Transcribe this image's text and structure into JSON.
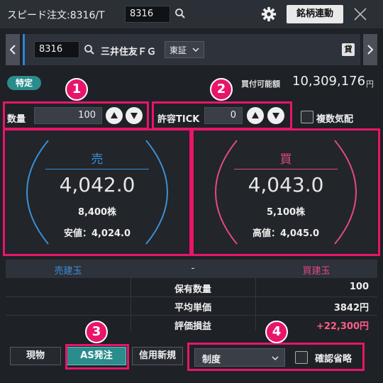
{
  "titlebar": {
    "title": "スピード注文:8316/T",
    "code_value": "8316",
    "link_button_label": "銘柄連動"
  },
  "stock": {
    "code_value": "8316",
    "name": "三井住友ＦＧ",
    "market": "東証",
    "loan_badge": "貸"
  },
  "account": {
    "tag": "特定",
    "buying_power_label": "買付可能額",
    "buying_power_value": "10,309,176",
    "buying_power_unit": "円"
  },
  "quantity": {
    "label": "数量",
    "value": "100"
  },
  "tick": {
    "label": "許容TICK",
    "value": "0"
  },
  "multi_display": {
    "label": "複数気配",
    "checked": false
  },
  "sell_panel": {
    "side": "売",
    "price": "4,042.0",
    "quantity": "8,400株",
    "extreme": "安値：4,024.0",
    "color": "#3a8ed6"
  },
  "buy_panel": {
    "side": "買",
    "price": "4,043.0",
    "quantity": "5,100株",
    "extreme": "高値：4,045.0",
    "color": "#e04a82"
  },
  "positions": {
    "headers": [
      "売建玉",
      "-",
      "買建玉"
    ],
    "rows": [
      {
        "label": "保有数量",
        "value": "100"
      },
      {
        "label": "平均単価",
        "value": "3842円"
      },
      {
        "label": "評価損益",
        "value": "+22,300円",
        "color": "#ff5c8a"
      }
    ]
  },
  "tabs": {
    "physical": "現物",
    "as_order": "AS発注",
    "margin_new": "信用新規"
  },
  "system_select": {
    "value": "制度"
  },
  "confirm_skip": {
    "label": "確認省略",
    "checked": false
  },
  "annotations": {
    "badge1": "1",
    "badge2": "2",
    "badge3": "3",
    "badge4": "4"
  },
  "colors": {
    "highlight": "#e8156a",
    "accent_teal": "#2a8c8c"
  }
}
